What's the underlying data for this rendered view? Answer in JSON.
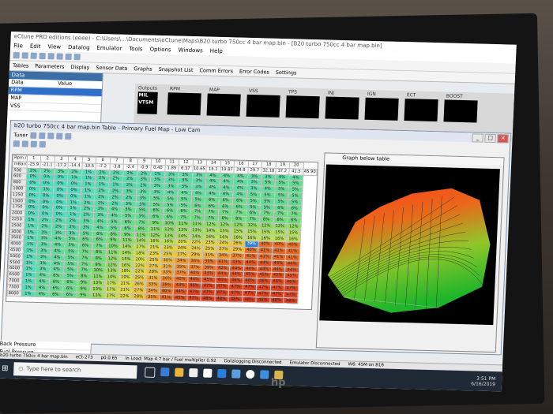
{
  "window": {
    "title": "eCtune PRO editions (eeee) - C:\\Users\\...\\Documents\\eCtune\\Maps\\B20 turbo 750cc 4 bar map.bin - [B20 turbo 750cc 4 bar map.bin]",
    "menu": [
      "File",
      "Edit",
      "View",
      "Datalog",
      "Emulator",
      "Tools",
      "Options",
      "Windows",
      "Help"
    ],
    "toolbar2": [
      "Tables",
      "Parameters",
      "Display",
      "Sensor Data",
      "Graphs",
      "Snapshot List",
      "Comm Errors",
      "Error Codes",
      "Settings"
    ]
  },
  "datapanel": {
    "title": "Data",
    "columns": [
      "Data",
      "Value"
    ],
    "rows": [
      "RPM",
      "MAP",
      "VSS"
    ]
  },
  "gauges": {
    "title": "Display",
    "outputs_label": "Outputs",
    "indicators": [
      "MIL",
      "VTSM"
    ],
    "labels": [
      "RPM",
      "MAP",
      "VSS",
      "TPS",
      "INJ",
      "IGN",
      "ECT",
      "BOOST"
    ]
  },
  "table_window": {
    "title": "b20 turbo 750cc 4 bar map.bin Table - Primary Fuel Map - Low Cam",
    "tuner_label": "Tuner",
    "rpm_map_label": "Rpm / Col",
    "col_index": [
      "",
      "1",
      "2",
      "3",
      "4",
      "5",
      "6",
      "7",
      "8",
      "9",
      "10",
      "11",
      "12",
      "13",
      "14",
      "15",
      "16",
      "17",
      "18",
      "19",
      "20"
    ],
    "col_values": [
      "mBar/psi",
      "-25.9",
      "-21.1",
      "-17.2",
      "-14.4",
      "-10.5",
      "-7.2",
      "-3.8",
      "-2.4",
      "-0.9",
      "0.40",
      "1.89",
      "6.37",
      "10.65",
      "15.1",
      "19.87",
      "24.9",
      "29.7",
      "32.10",
      "37.2",
      "41.5",
      "45.90"
    ],
    "rows": [
      {
        "rpm": "500",
        "cells": [
          "2%",
          "2%",
          "3%",
          "2%",
          "1%",
          "2%",
          "2%",
          "2%",
          "2%",
          "1%",
          "3%",
          "3%",
          "3%",
          "4%",
          "4%",
          "4%",
          "3%",
          "3%",
          "4%",
          "4%"
        ]
      },
      {
        "rpm": "600",
        "cells": [
          "0%",
          "0%",
          "0%",
          "1%",
          "1%",
          "2%",
          "2%",
          "2%",
          "3%",
          "3%",
          "3%",
          "3%",
          "3%",
          "4%",
          "4%",
          "4%",
          "3%",
          "5%",
          "5%",
          "5%"
        ]
      },
      {
        "rpm": "800",
        "cells": [
          "0%",
          "0%",
          "0%",
          "0%",
          "1%",
          "1%",
          "1%",
          "2%",
          "2%",
          "3%",
          "3%",
          "3%",
          "3%",
          "4%",
          "4%",
          "4%",
          "3%",
          "4%",
          "5%",
          "5%"
        ]
      },
      {
        "rpm": "1000",
        "cells": [
          "0%",
          "1%",
          "0%",
          "0%",
          "1%",
          "2%",
          "2%",
          "3%",
          "3%",
          "3%",
          "4%",
          "4%",
          "4%",
          "4%",
          "4%",
          "4%",
          "5%",
          "5%",
          "5%",
          "5%"
        ]
      },
      {
        "rpm": "1250",
        "cells": [
          "0%",
          "0%",
          "0%",
          "0%",
          "1%",
          "2%",
          "2%",
          "2%",
          "3%",
          "5%",
          "5%",
          "5%",
          "5%",
          "6%",
          "6%",
          "6%",
          "5%",
          "5%",
          "5%",
          "5%"
        ]
      },
      {
        "rpm": "1500",
        "cells": [
          "0%",
          "0%",
          "0%",
          "1%",
          "2%",
          "2%",
          "2%",
          "3%",
          "3%",
          "5%",
          "5%",
          "5%",
          "6%",
          "6%",
          "6%",
          "6%",
          "5%",
          "5%",
          "6%",
          "6%"
        ]
      },
      {
        "rpm": "1750",
        "cells": [
          "0%",
          "0%",
          "0%",
          "1%",
          "2%",
          "3%",
          "4%",
          "5%",
          "5%",
          "6%",
          "6%",
          "6%",
          "7%",
          "7%",
          "7%",
          "7%",
          "6%",
          "7%",
          "7%",
          "7%"
        ]
      },
      {
        "rpm": "2000",
        "cells": [
          "0%",
          "0%",
          "0%",
          "1%",
          "2%",
          "3%",
          "4%",
          "5%",
          "5%",
          "6%",
          "6%",
          "7%",
          "7%",
          "7%",
          "8%",
          "8%",
          "7%",
          "8%",
          "8%",
          "8%"
        ]
      },
      {
        "rpm": "2250",
        "cells": [
          "1%",
          "2%",
          "2%",
          "2%",
          "3%",
          "4%",
          "5%",
          "6%",
          "7%",
          "9%",
          "10%",
          "11%",
          "11%",
          "12%",
          "12%",
          "12%",
          "12%",
          "12%",
          "12%",
          "12%"
        ]
      },
      {
        "rpm": "2500",
        "cells": [
          "1%",
          "2%",
          "2%",
          "2%",
          "3%",
          "4%",
          "5%",
          "6%",
          "8%",
          "11%",
          "12%",
          "13%",
          "13%",
          "14%",
          "15%",
          "15%",
          "15%",
          "15%",
          "15%",
          "15%"
        ]
      },
      {
        "rpm": "3000",
        "cells": [
          "1%",
          "3%",
          "3%",
          "3%",
          "5%",
          "6%",
          "8%",
          "9%",
          "11%",
          "12%",
          "13%",
          "14%",
          "14%",
          "16%",
          "16%",
          "16%",
          "16%",
          "16%",
          "16%",
          "16%"
        ]
      },
      {
        "rpm": "3500",
        "cells": [
          "1%",
          "3%",
          "4%",
          "5%",
          "6%",
          "6%",
          "9%",
          "11%",
          "14%",
          "16%",
          "16%",
          "20%",
          "22%",
          "23%",
          "24%",
          "26%",
          "39%",
          "40%",
          "40%",
          "40%"
        ]
      },
      {
        "rpm": "4000",
        "cells": [
          "1%",
          "3%",
          "4%",
          "5%",
          "6%",
          "7%",
          "10%",
          "14%",
          "17%",
          "21%",
          "23%",
          "24%",
          "24%",
          "25%",
          "27%",
          "29%",
          "40%",
          "41%",
          "41%",
          "41%"
        ]
      },
      {
        "rpm": "4500",
        "cells": [
          "1%",
          "3%",
          "4%",
          "5%",
          "7%",
          "8%",
          "11%",
          "14%",
          "18%",
          "23%",
          "25%",
          "27%",
          "29%",
          "31%",
          "34%",
          "37%",
          "41%",
          "41%",
          "41%",
          "41%"
        ]
      },
      {
        "rpm": "5000",
        "cells": [
          "1%",
          "3%",
          "4%",
          "5%",
          "7%",
          "8%",
          "12%",
          "15%",
          "20%",
          "25%",
          "30%",
          "34%",
          "36%",
          "39%",
          "41%",
          "43%",
          "44%",
          "44%",
          "44%",
          "44%"
        ]
      },
      {
        "rpm": "5500",
        "cells": [
          "1%",
          "3%",
          "4%",
          "5%",
          "7%",
          "9%",
          "12%",
          "16%",
          "22%",
          "27%",
          "31%",
          "35%",
          "37%",
          "39%",
          "42%",
          "44%",
          "44%",
          "44%",
          "44%",
          "44%"
        ]
      },
      {
        "rpm": "6000",
        "cells": [
          "1%",
          "3%",
          "4%",
          "5%",
          "7%",
          "10%",
          "13%",
          "18%",
          "22%",
          "28%",
          "33%",
          "37%",
          "40%",
          "43%",
          "44%",
          "44%",
          "45%",
          "45%",
          "45%",
          "45%"
        ]
      },
      {
        "rpm": "6500",
        "cells": [
          "1%",
          "4%",
          "6%",
          "5%",
          "8%",
          "11%",
          "14%",
          "19%",
          "25%",
          "31%",
          "36%",
          "40%",
          "44%",
          "45%",
          "46%",
          "46%",
          "46%",
          "46%",
          "46%",
          "46%"
        ]
      },
      {
        "rpm": "7000",
        "cells": [
          "1%",
          "4%",
          "6%",
          "6%",
          "9%",
          "13%",
          "17%",
          "21%",
          "26%",
          "33%",
          "39%",
          "43%",
          "46%",
          "47%",
          "47%",
          "47%",
          "47%",
          "47%",
          "47%",
          "47%"
        ]
      },
      {
        "rpm": "7500",
        "cells": [
          "1%",
          "4%",
          "6%",
          "6%",
          "9%",
          "13%",
          "17%",
          "21%",
          "27%",
          "34%",
          "40%",
          "44%",
          "47%",
          "47%",
          "47%",
          "47%",
          "47%",
          "47%",
          "47%",
          "47%"
        ]
      },
      {
        "rpm": "8000",
        "cells": [
          "1%",
          "4%",
          "6%",
          "6%",
          "9%",
          "13%",
          "17%",
          "22%",
          "28%",
          "35%",
          "41%",
          "45%",
          "47%",
          "48%",
          "48%",
          "48%",
          "48%",
          "48%",
          "48%",
          "48%"
        ]
      }
    ]
  },
  "graph_window": {
    "title": "Graph below table"
  },
  "sidelist": [
    "Back Pressure",
    "Fuel Pressure"
  ],
  "statusbar": [
    "b20 turbo 750cc 4 bar map.bin",
    "eCt-273",
    "p0.0.65",
    "In Load: Map 4.7 bar / Fuel multiplier 0.92",
    "Datalogging Disconnected",
    "Emulator Disconnected",
    "W6: 45M on B16"
  ],
  "taskbar": {
    "search_placeholder": "Type here to search",
    "clock_time": "3:51 PM",
    "clock_date": "6/16/2019"
  },
  "brand": "hp"
}
